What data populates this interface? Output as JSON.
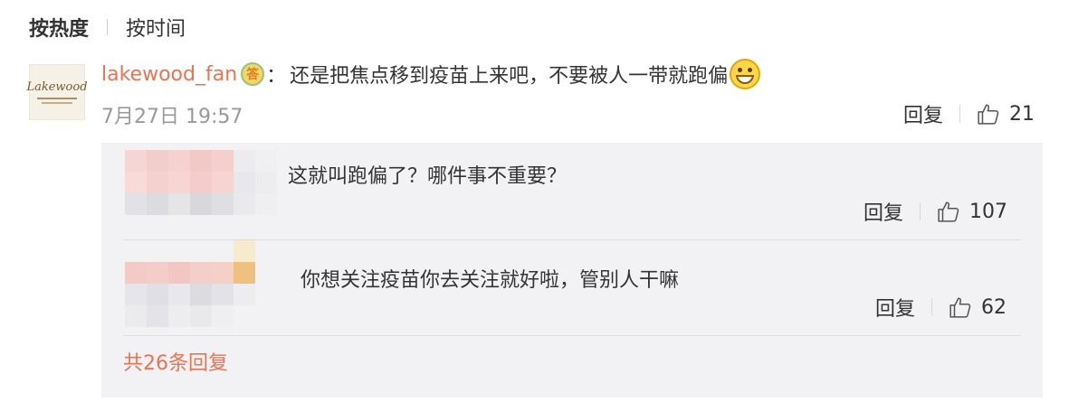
{
  "sort": {
    "hot_label": "按热度",
    "time_label": "按时间"
  },
  "comment": {
    "username": "lakewood_fan",
    "badge_label": "答",
    "colon": "：",
    "text": "还是把焦点移到疫苗上来吧，不要被人一带就跑偏",
    "emoji": "grinning-face-icon",
    "timestamp": "7月27日 19:57",
    "reply_label": "回复",
    "likes": "21",
    "avatar_text": "Lakewood"
  },
  "replies": [
    {
      "text": "这就叫跑偏了？哪件事不重要？",
      "reply_label": "回复",
      "likes": "107"
    },
    {
      "text": "你想关注疫苗你去关注就好啦，管别人干嘛",
      "reply_label": "回复",
      "likes": "62"
    }
  ],
  "more_replies": "共26条回复",
  "colors": {
    "accent": "#eb7350",
    "reply_bg": "#f2f2f5",
    "muted": "#999999"
  }
}
